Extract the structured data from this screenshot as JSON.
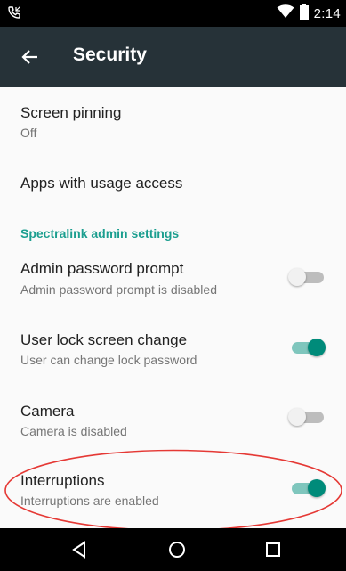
{
  "status_bar": {
    "time": "2:14",
    "icons": [
      "phone-icon",
      "wifi-icon",
      "battery-icon"
    ]
  },
  "app_bar": {
    "title": "Security",
    "back_icon": "arrow-back-icon",
    "background": "#263238"
  },
  "items": [
    {
      "title": "Screen pinning",
      "subtitle": "Off"
    },
    {
      "title": "Apps with usage access"
    }
  ],
  "section_header": "Spectralink admin settings",
  "toggles": [
    {
      "title": "Admin password prompt",
      "subtitle": "Admin password prompt is disabled",
      "checked": false
    },
    {
      "title": "User lock screen change",
      "subtitle": "User can change lock password",
      "checked": true
    },
    {
      "title": "Camera",
      "subtitle": "Camera is disabled",
      "checked": false
    },
    {
      "title": "Interruptions",
      "subtitle": "Interruptions are enabled",
      "checked": true
    }
  ],
  "colors": {
    "accent": "#008b7a",
    "section_header": "#1b9e8f",
    "annotation": "#e53935"
  },
  "nav_bar": {
    "buttons": [
      "back-triangle-icon",
      "home-circle-icon",
      "recents-square-icon"
    ]
  }
}
